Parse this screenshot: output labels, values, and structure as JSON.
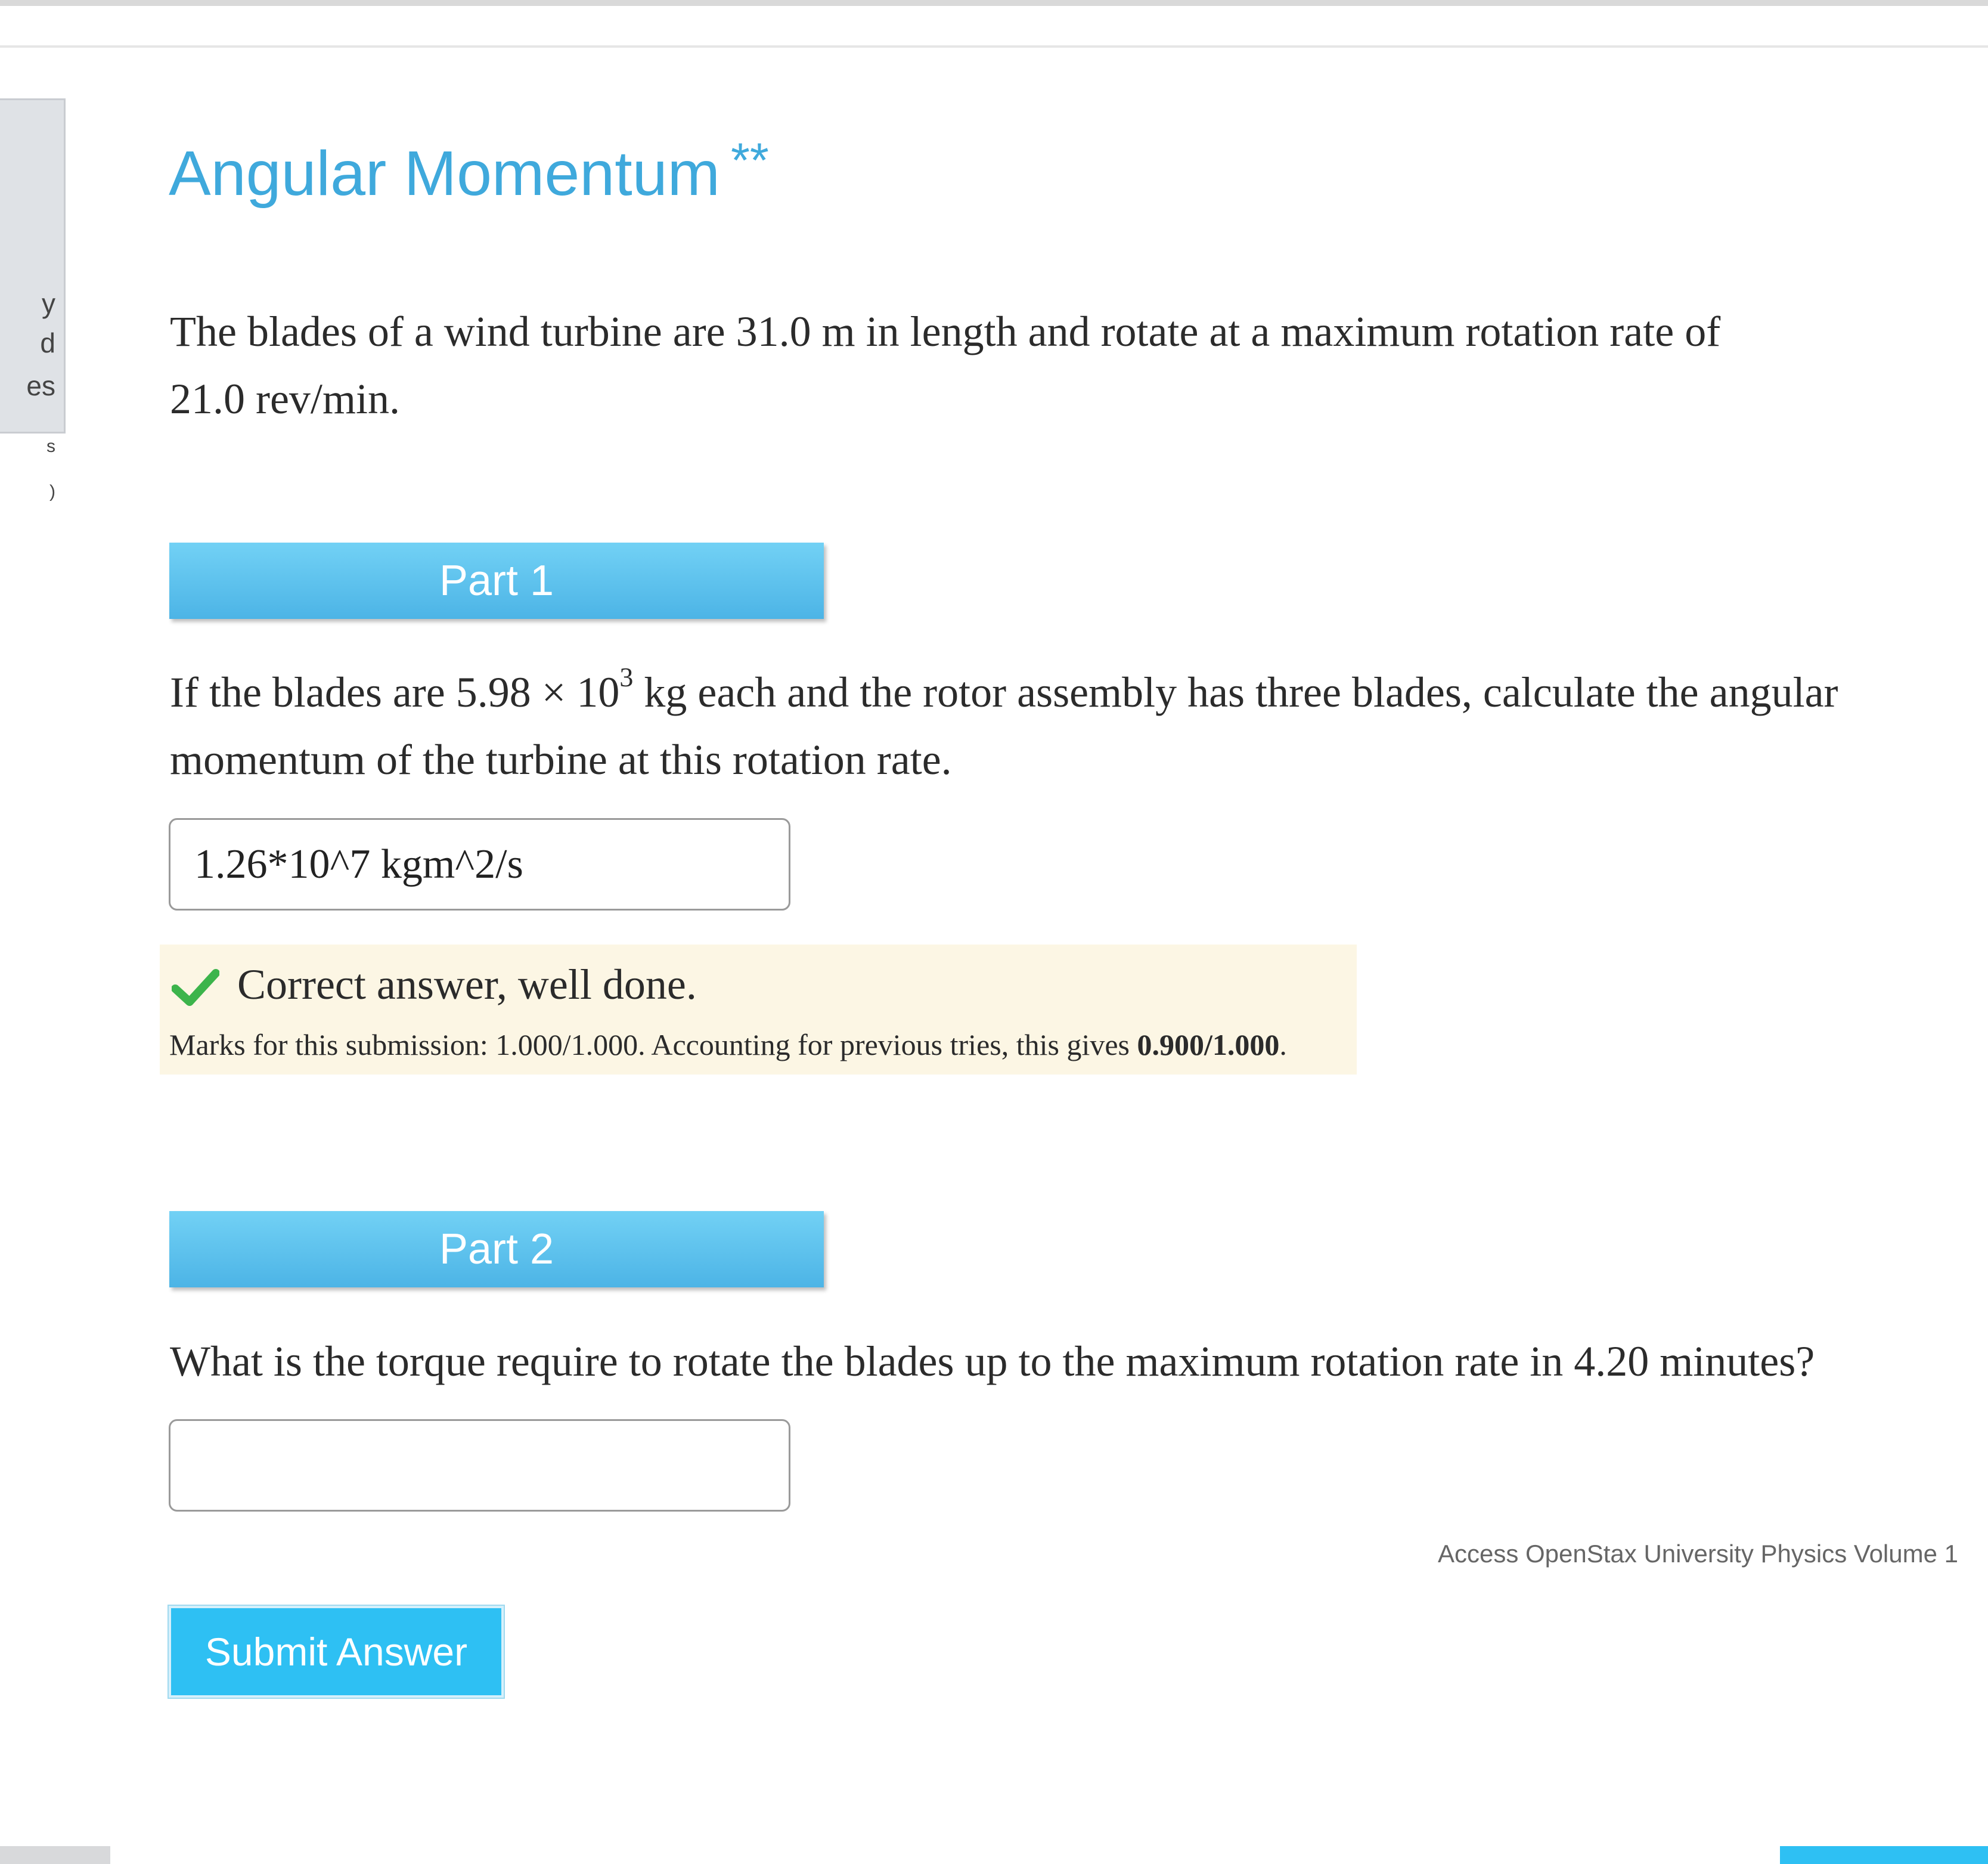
{
  "sidebar": {
    "fragments": [
      "y",
      "d",
      "es",
      "s",
      ")"
    ]
  },
  "question": {
    "title": "Angular Momentum",
    "difficulty": "**",
    "intro_line1": "The blades of a wind turbine are 31.0 m in length and rotate at a maximum rotation rate of",
    "intro_line2": "21.0 rev/min."
  },
  "parts": [
    {
      "label": "Part 1",
      "question_before": "If the blades are 5.98 × 10",
      "question_exponent": "3",
      "question_after": " kg each and the rotor assembly has three blades, calculate the angular momentum of the turbine at this rotation rate.",
      "answer_value": "1.26*10^7 kgm^2/s",
      "feedback": {
        "message": "Correct answer, well done.",
        "marks_prefix": "Marks for this submission: 1.000/1.000. Accounting for previous tries, this gives ",
        "marks_total": "0.900/1.000",
        "marks_suffix": "."
      }
    },
    {
      "label": "Part 2",
      "question": "What is the torque require to rotate the blades up to the maximum rotation rate in 4.20 minutes?",
      "answer_value": ""
    }
  ],
  "footer": {
    "source_link": "Access OpenStax University Physics Volume 1",
    "submit_label": "Submit Answer"
  },
  "colors": {
    "accent_blue": "#3fa9dc",
    "part_header_top": "#72d1f5",
    "part_header_bottom": "#4cb4e6",
    "submit_blue": "#2ec0f3",
    "feedback_bg": "#fcf6e4",
    "check_green": "#3cb44b"
  },
  "icons": {
    "feedback": "check-icon"
  }
}
